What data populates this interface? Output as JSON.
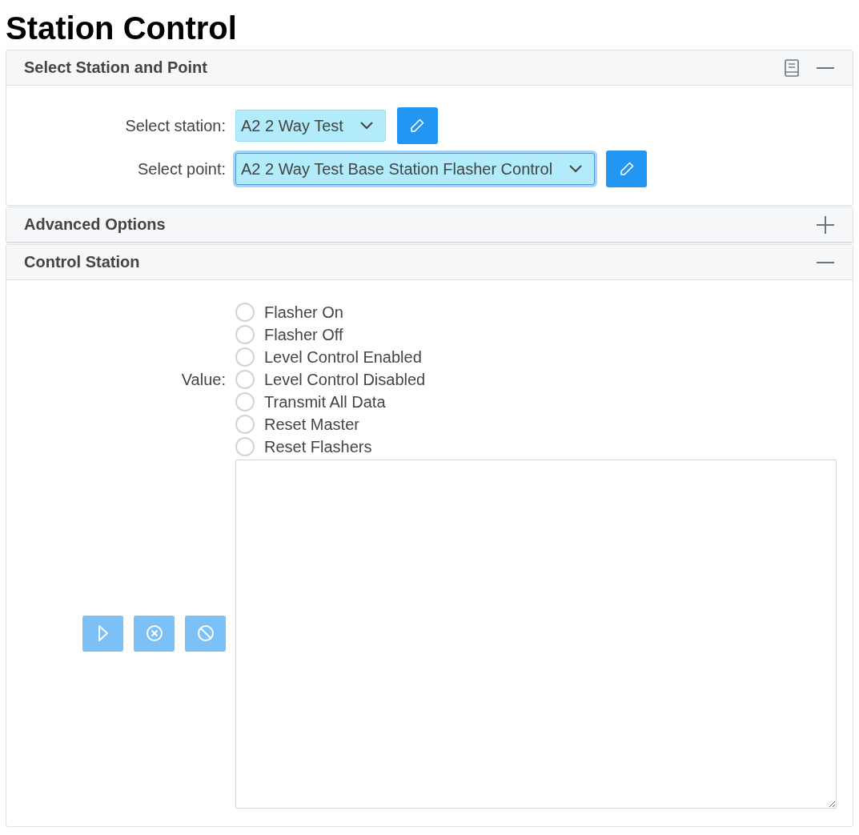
{
  "page_title": "Station Control",
  "select_panel": {
    "title": "Select Station and Point",
    "expanded": true,
    "fields": [
      {
        "label": "Select station:",
        "value": "A2 2 Way Test",
        "focused": false
      },
      {
        "label": "Select point:",
        "value": "A2 2 Way Test Base Station Flasher Control",
        "focused": true
      }
    ]
  },
  "advanced_panel": {
    "title": "Advanced Options",
    "expanded": false
  },
  "control_panel": {
    "title": "Control Station",
    "expanded": true,
    "value_label": "Value:",
    "options": [
      {
        "label": "Flasher On",
        "checked": false
      },
      {
        "label": "Flasher Off",
        "checked": false
      },
      {
        "label": "Level Control Enabled",
        "checked": false
      },
      {
        "label": "Level Control Disabled",
        "checked": false
      },
      {
        "label": "Transmit All Data",
        "checked": false
      },
      {
        "label": "Reset Master",
        "checked": false
      },
      {
        "label": "Reset Flashers",
        "checked": false
      }
    ],
    "actions": [
      {
        "kind": "play",
        "disabled": true
      },
      {
        "kind": "cancel",
        "disabled": true
      },
      {
        "kind": "block",
        "disabled": true
      }
    ]
  }
}
